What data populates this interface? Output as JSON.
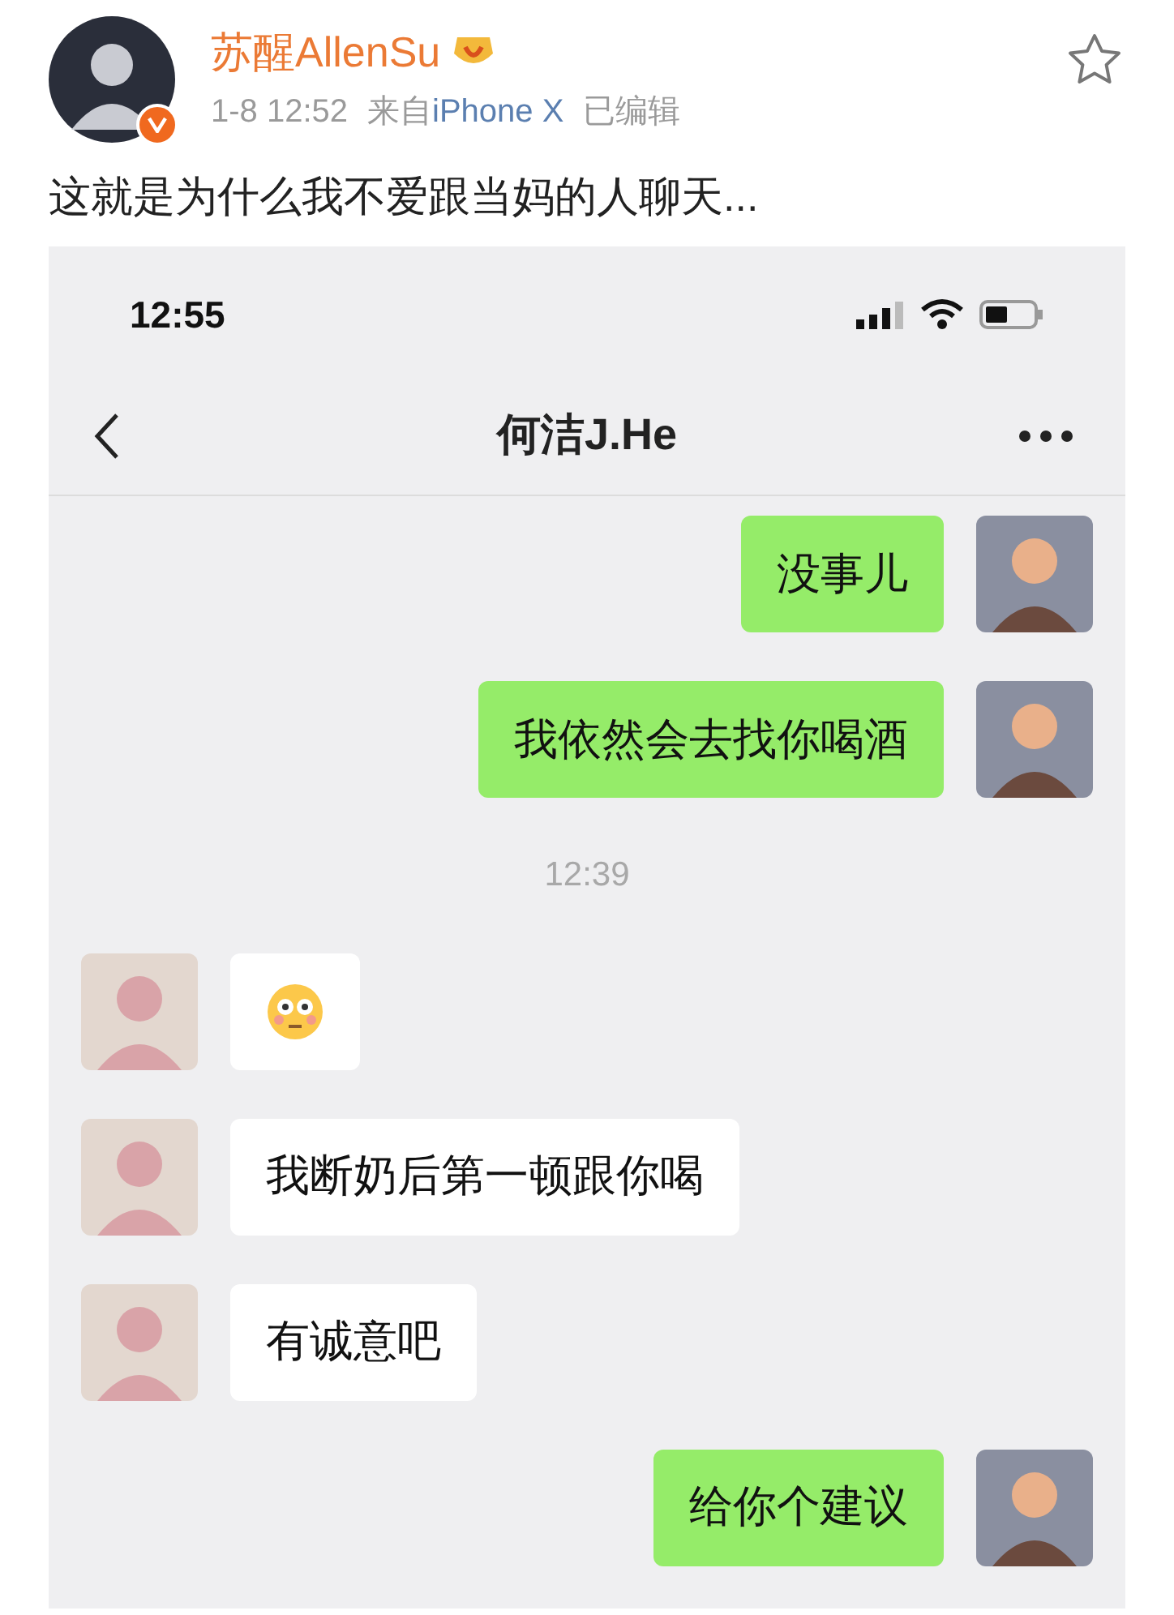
{
  "post": {
    "author": "苏醒AllenSu",
    "time": "1-8 12:52",
    "source_prefix": "来自",
    "source": "iPhone X",
    "edited": "已编辑",
    "text": "这就是为什么我不爱跟当妈的人聊天...",
    "starred": false
  },
  "phone": {
    "clock": "12:55",
    "chat_title": "何洁J.He",
    "messages": [
      {
        "kind": "outgoing",
        "text": "没事儿"
      },
      {
        "kind": "outgoing",
        "text": "我依然会去找你喝酒"
      },
      {
        "kind": "time",
        "text": "12:39"
      },
      {
        "kind": "incoming_emoji"
      },
      {
        "kind": "incoming",
        "text": "我断奶后第一顿跟你喝"
      },
      {
        "kind": "incoming",
        "text": "有诚意吧"
      },
      {
        "kind": "outgoing",
        "text": "给你个建议"
      }
    ]
  }
}
